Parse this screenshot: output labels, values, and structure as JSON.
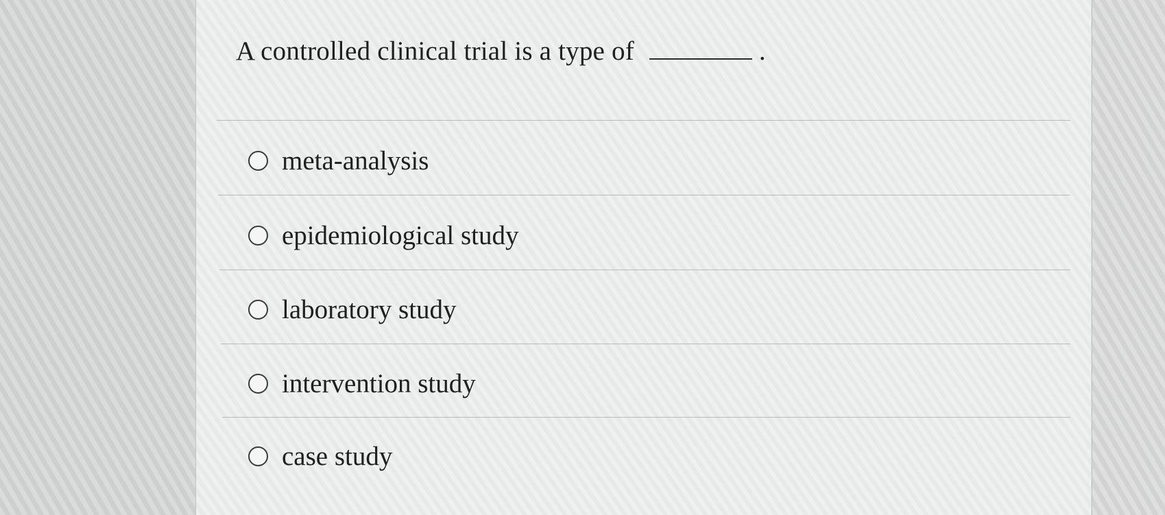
{
  "question": {
    "text": "A controlled clinical trial is a type of",
    "trailing_punctuation": "."
  },
  "options": [
    {
      "label": "meta-analysis",
      "selected": false
    },
    {
      "label": "epidemiological study",
      "selected": false
    },
    {
      "label": "laboratory study",
      "selected": false
    },
    {
      "label": "intervention study",
      "selected": false
    },
    {
      "label": "case study",
      "selected": false
    }
  ]
}
